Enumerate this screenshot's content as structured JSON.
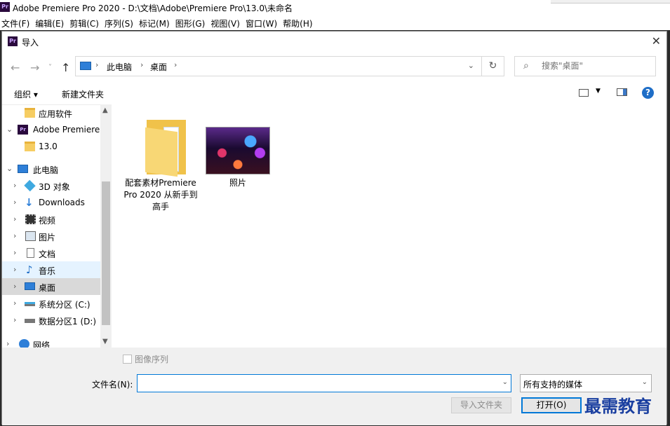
{
  "app": {
    "title": "Adobe Premiere Pro 2020 - D:\\文档\\Adobe\\Premiere Pro\\13.0\\未命名",
    "logo_text": "Pr",
    "menu": [
      "文件(F)",
      "编辑(E)",
      "剪辑(C)",
      "序列(S)",
      "标记(M)",
      "图形(G)",
      "视图(V)",
      "窗口(W)",
      "帮助(H)"
    ]
  },
  "dialog": {
    "title": "导入",
    "close": "✕",
    "address": {
      "crumbs": [
        "此电脑",
        "桌面"
      ]
    },
    "search": {
      "placeholder": "搜索\"桌面\""
    },
    "toolbar": {
      "organize": "组织 ▾",
      "new_folder": "新建文件夹",
      "help": "?"
    },
    "tree": [
      {
        "label": "应用软件",
        "icon": "folder-icon",
        "state": ""
      },
      {
        "label": "Adobe Premiere",
        "icon": "premiere-icon",
        "state": "expanded"
      },
      {
        "label": "13.0",
        "icon": "folder-icon",
        "state": ""
      },
      {
        "label": "此电脑",
        "icon": "computer-icon",
        "state": "expanded"
      },
      {
        "label": "3D 对象",
        "icon": "cube-icon",
        "state": ""
      },
      {
        "label": "Downloads",
        "icon": "download-icon",
        "state": ""
      },
      {
        "label": "视频",
        "icon": "video-icon",
        "state": ""
      },
      {
        "label": "图片",
        "icon": "picture-icon",
        "state": ""
      },
      {
        "label": "文档",
        "icon": "document-icon",
        "state": ""
      },
      {
        "label": "音乐",
        "icon": "music-icon",
        "state": "hover"
      },
      {
        "label": "桌面",
        "icon": "desktop-icon",
        "state": "selected"
      },
      {
        "label": "系统分区 (C:)",
        "icon": "drive-icon",
        "state": ""
      },
      {
        "label": "数据分区1 (D:)",
        "icon": "drive-icon",
        "state": ""
      },
      {
        "label": "网络",
        "icon": "network-icon",
        "state": ""
      }
    ],
    "files": [
      {
        "name": "配套素材Premiere Pro 2020 从新手到高手",
        "type": "folder"
      },
      {
        "name": "照片",
        "type": "image"
      }
    ],
    "image_sequence_label": "图像序列",
    "filename_label": "文件名(N):",
    "filename_value": "",
    "filetype_value": "所有支持的媒体",
    "import_folder_button": "导入文件夹",
    "open_button": "打开(O)"
  },
  "watermark": "最需教育",
  "colors": {
    "accent": "#0078d7",
    "selected": "#d9d9d9",
    "hover": "#e5f3ff",
    "premiere": "#2a0a3d"
  }
}
